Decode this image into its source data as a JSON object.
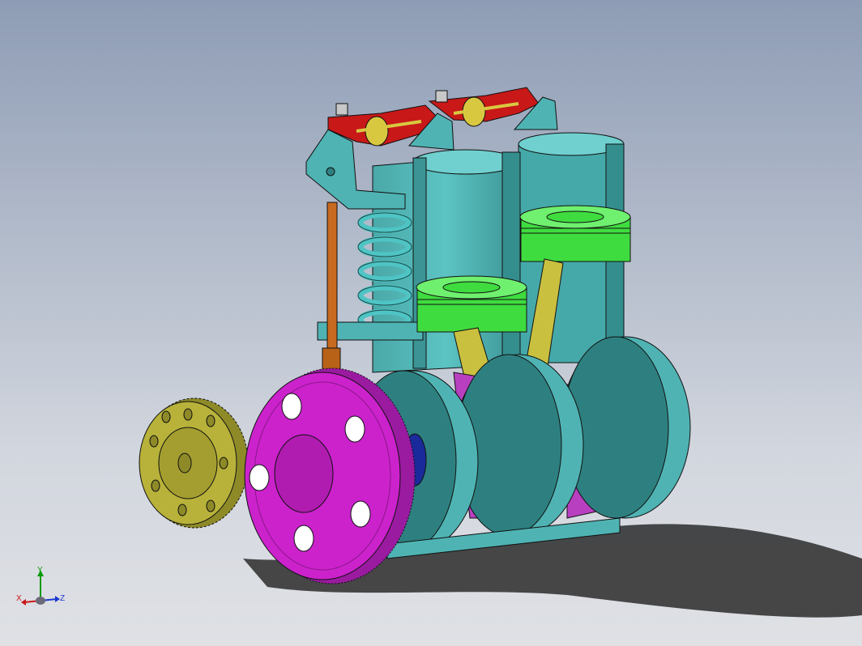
{
  "viewport": {
    "background_top": "#8e9cb5",
    "background_bottom": "#dfe1e5"
  },
  "colors": {
    "block": "#4fb3b3",
    "block_dark": "#2e7f80",
    "block_light": "#6fd0cf",
    "piston": "#3fdc3f",
    "piston_dark": "#22a022",
    "rod": "#c9c040",
    "crank": "#b83fc0",
    "big_gear": "#cc22cc",
    "small_gear": "#b8b23a",
    "rocker": "#c81818",
    "pushrod": "#c86a20",
    "bearing": "#1a2a9a"
  },
  "triad": {
    "x_label": "X",
    "y_label": "Y",
    "z_label": "Z"
  }
}
